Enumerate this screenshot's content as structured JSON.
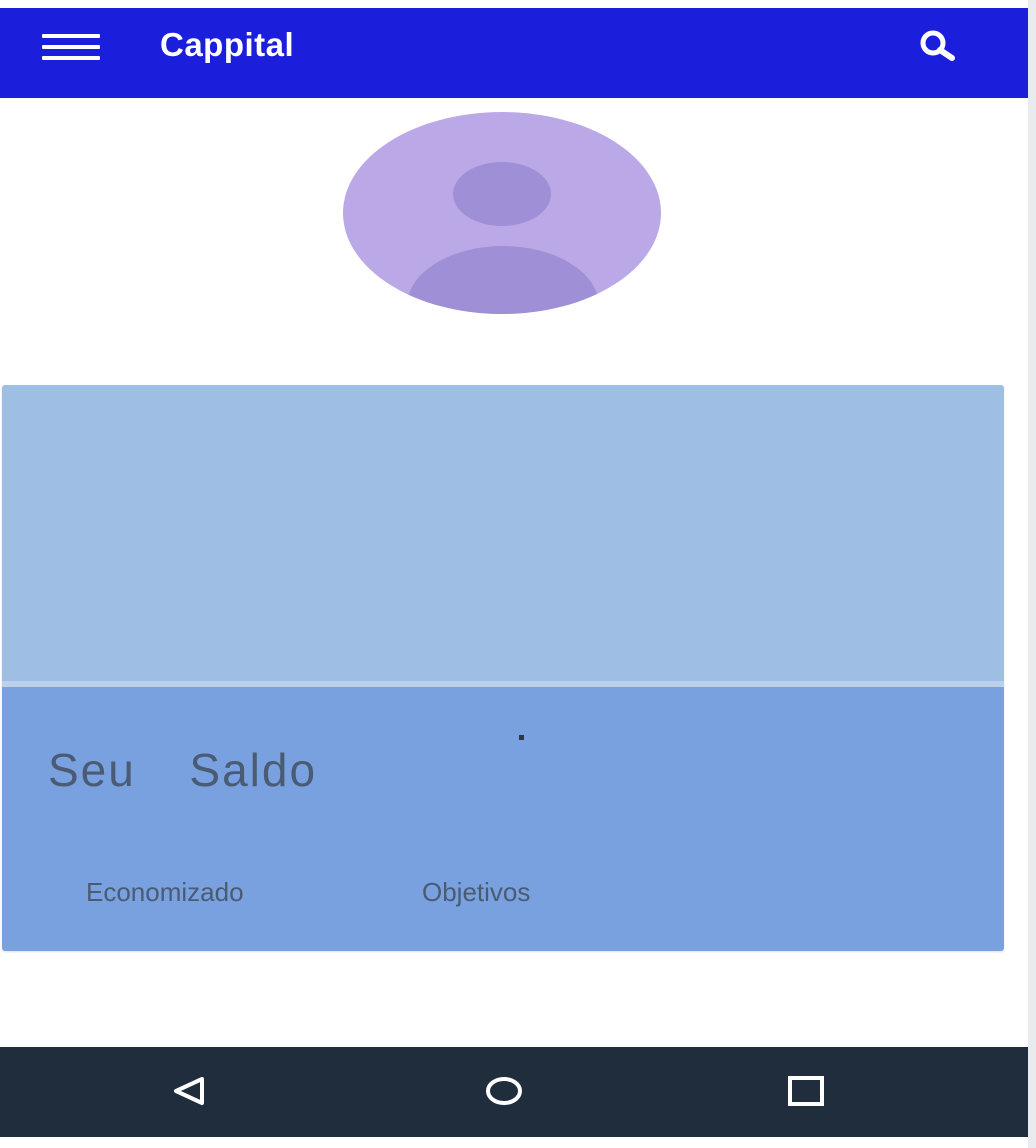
{
  "app_bar": {
    "title": "Cappital",
    "menu_icon": "menu-icon",
    "search_icon": "search-icon",
    "background": "#1b1fdc"
  },
  "profile": {
    "avatar_icon": "avatar-placeholder-icon",
    "avatar_color": "#bba8e6"
  },
  "card": {
    "top_color": "#9ebfe3",
    "bottom_color": "#79a1e0",
    "balance_label": "Seu  Saldo",
    "tabs": [
      {
        "label": "Economizado"
      },
      {
        "label": "Objetivos"
      }
    ]
  },
  "nav_bar": {
    "background": "#1f2d3d",
    "buttons": [
      {
        "icon": "back-triangle-icon"
      },
      {
        "icon": "home-circle-icon"
      },
      {
        "icon": "recents-square-icon"
      }
    ]
  }
}
